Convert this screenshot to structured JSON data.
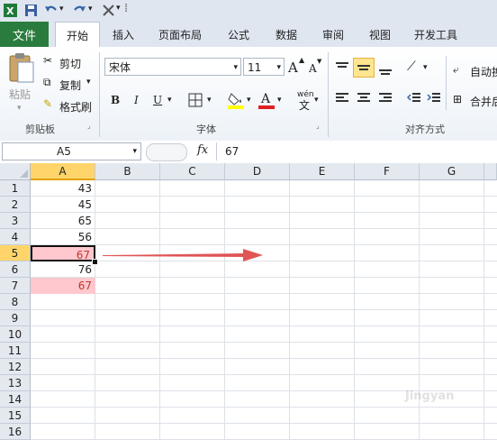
{
  "quick_access": {
    "icons": [
      "excel-logo-icon",
      "save-icon",
      "undo-icon",
      "redo-icon",
      "customize-icon"
    ]
  },
  "tabs": [
    "文件",
    "开始",
    "插入",
    "页面布局",
    "公式",
    "数据",
    "审阅",
    "视图",
    "开发工具"
  ],
  "ribbon": {
    "clipboard": {
      "paste": "粘贴",
      "cut": "剪切",
      "copy": "复制",
      "format_painter": "格式刷",
      "label": "剪贴板"
    },
    "font": {
      "name": "宋体",
      "size": "11",
      "label": "字体",
      "bold": "B",
      "italic": "I",
      "underline": "U",
      "grow": "A",
      "shrink": "A",
      "pinyin": "wén",
      "pinyin_char": "文"
    },
    "alignment": {
      "wrap": "自动换",
      "merge": "合并后",
      "label": "对齐方式"
    }
  },
  "formula_bar": {
    "name_box": "A5",
    "fx": "fx",
    "value": "67"
  },
  "grid": {
    "columns": [
      "A",
      "B",
      "C",
      "D",
      "E",
      "F",
      "G"
    ],
    "rows": [
      "1",
      "2",
      "3",
      "4",
      "5",
      "6",
      "7",
      "8",
      "9",
      "10",
      "11",
      "12",
      "13",
      "14",
      "15",
      "16"
    ],
    "column_a_values": [
      "43",
      "45",
      "65",
      "56",
      "67",
      "76",
      "67"
    ],
    "selected_cell": "A5",
    "highlight_color": "#ffc7ce",
    "highlight_text_color": "#c0392b"
  },
  "watermark": "Jingyan"
}
